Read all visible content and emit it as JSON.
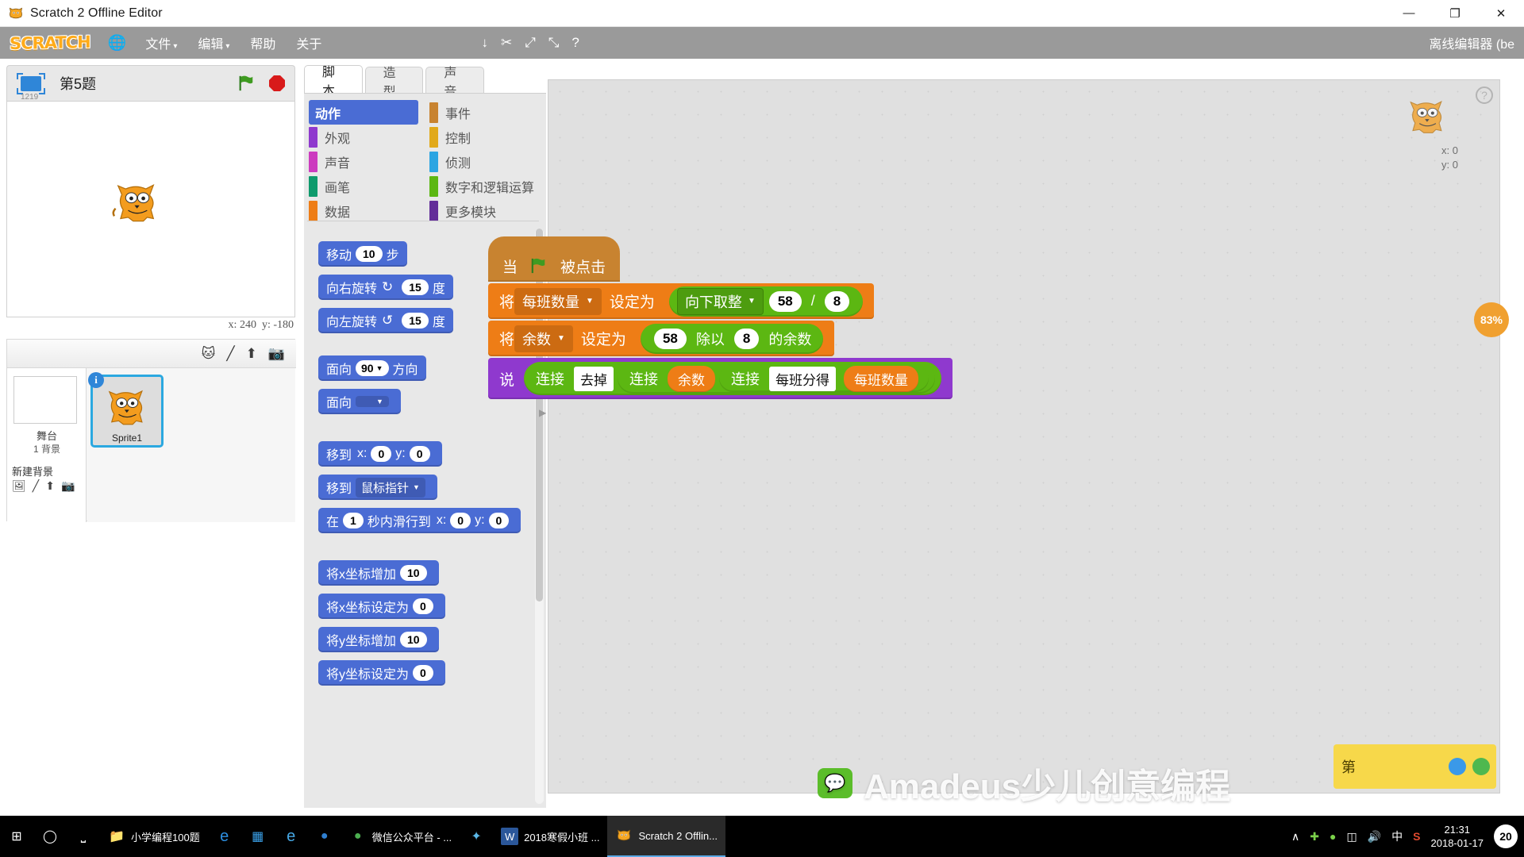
{
  "window": {
    "title": "Scratch 2 Offline Editor",
    "icon": "scratch-cat-icon",
    "minimize": "—",
    "maximize": "❐",
    "close": "✕"
  },
  "menubar": {
    "logo": "SCRATCH",
    "globe_icon": "globe-icon",
    "items": [
      {
        "label": "文件",
        "caret": "▾"
      },
      {
        "label": "编辑",
        "caret": "▾"
      },
      {
        "label": "帮助",
        "caret": ""
      },
      {
        "label": "关于",
        "caret": ""
      }
    ],
    "tools": [
      "↓",
      "✂",
      "⤢",
      "⤡",
      "?"
    ],
    "right_text": "离线编辑器 (be"
  },
  "stage": {
    "mini_number": "1219",
    "project_title": "第5题",
    "green_flag_icon": "green-flag-icon",
    "stop_icon": "stop-button-icon",
    "coords": {
      "x_label": "x:",
      "x_value": "240",
      "y_label": "y:",
      "y_value": "-180"
    }
  },
  "sprite_pane": {
    "tools": [
      "✨",
      "╱",
      "↑",
      "■"
    ],
    "stage_label": "舞台",
    "stage_sublabel": "1 背景",
    "new_bg_label": "新建背景",
    "new_bg_tools": [
      "Ὓc",
      "╱",
      "↑",
      "■"
    ],
    "sprites": [
      {
        "name": "Sprite1",
        "badge": "i"
      }
    ]
  },
  "editor_tabs": [
    {
      "label": "脚本",
      "active": true
    },
    {
      "label": "造型",
      "active": false
    },
    {
      "label": "声音",
      "active": false
    }
  ],
  "palette": {
    "categories_left": [
      {
        "label": "动作",
        "color": "#4a6cd4",
        "selected": true
      },
      {
        "label": "外观",
        "color": "#8f39ce",
        "selected": false
      },
      {
        "label": "声音",
        "color": "#cc3bbf",
        "selected": false
      },
      {
        "label": "画笔",
        "color": "#0e9a6c",
        "selected": false
      },
      {
        "label": "数据",
        "color": "#ee7d16",
        "selected": false
      }
    ],
    "categories_right": [
      {
        "label": "事件",
        "color": "#c88330",
        "selected": false
      },
      {
        "label": "控制",
        "color": "#e1a91a",
        "selected": false
      },
      {
        "label": "侦测",
        "color": "#2ca5e2",
        "selected": false
      },
      {
        "label": "数字和逻辑运算",
        "color": "#5cb712",
        "selected": false
      },
      {
        "label": "更多模块",
        "color": "#632d99",
        "selected": false
      }
    ],
    "blocks": [
      {
        "id": "move-steps",
        "parts": [
          {
            "t": "text",
            "v": "移动"
          },
          {
            "t": "oval",
            "v": "10"
          },
          {
            "t": "text",
            "v": "步"
          }
        ]
      },
      {
        "id": "turn-right",
        "parts": [
          {
            "t": "text",
            "v": "向右旋转"
          },
          {
            "t": "icon",
            "v": "↻"
          },
          {
            "t": "oval",
            "v": "15"
          },
          {
            "t": "text",
            "v": "度"
          }
        ]
      },
      {
        "id": "turn-left",
        "parts": [
          {
            "t": "text",
            "v": "向左旋转"
          },
          {
            "t": "icon",
            "v": "↺"
          },
          {
            "t": "oval",
            "v": "15"
          },
          {
            "t": "text",
            "v": "度"
          }
        ]
      },
      {
        "id": "point-in-direction",
        "parts": [
          {
            "t": "text",
            "v": "面向"
          },
          {
            "t": "ovaldrop",
            "v": "90"
          },
          {
            "t": "text",
            "v": "方向"
          }
        ]
      },
      {
        "id": "point-towards",
        "parts": [
          {
            "t": "text",
            "v": "面向"
          },
          {
            "t": "drop",
            "v": ""
          }
        ]
      },
      {
        "id": "go-to-xy",
        "parts": [
          {
            "t": "text",
            "v": "移到"
          },
          {
            "t": "text",
            "v": "x:"
          },
          {
            "t": "oval",
            "v": "0"
          },
          {
            "t": "text",
            "v": "y:"
          },
          {
            "t": "oval",
            "v": "0"
          }
        ]
      },
      {
        "id": "go-to-pointer",
        "parts": [
          {
            "t": "text",
            "v": "移到"
          },
          {
            "t": "drop",
            "v": "鼠标指针"
          }
        ]
      },
      {
        "id": "glide-secs",
        "parts": [
          {
            "t": "text",
            "v": "在"
          },
          {
            "t": "oval",
            "v": "1"
          },
          {
            "t": "text",
            "v": "秒内滑行到"
          },
          {
            "t": "text",
            "v": "x:"
          },
          {
            "t": "oval",
            "v": "0"
          },
          {
            "t": "text",
            "v": "y:"
          },
          {
            "t": "oval",
            "v": "0"
          }
        ]
      },
      {
        "id": "change-x-by",
        "parts": [
          {
            "t": "text",
            "v": "将x坐标增加"
          },
          {
            "t": "oval",
            "v": "10"
          }
        ]
      },
      {
        "id": "set-x-to",
        "parts": [
          {
            "t": "text",
            "v": "将x坐标设定为"
          },
          {
            "t": "oval",
            "v": "0"
          }
        ]
      },
      {
        "id": "change-y-by",
        "parts": [
          {
            "t": "text",
            "v": "将y坐标增加"
          },
          {
            "t": "oval",
            "v": "10"
          }
        ]
      },
      {
        "id": "set-y-to",
        "parts": [
          {
            "t": "text",
            "v": "将y坐标设定为"
          },
          {
            "t": "oval",
            "v": "0"
          }
        ]
      }
    ]
  },
  "script": {
    "hat": {
      "when": "当",
      "flag_icon": "green-flag-icon",
      "clicked": "被点击"
    },
    "set_block_1": {
      "set_word": "将",
      "variable": "每班数量",
      "to_word": "设定为",
      "operator": "向下取整",
      "operand_a": "58",
      "op_symbol": "/",
      "operand_b": "8"
    },
    "set_block_2": {
      "set_word": "将",
      "variable": "余数",
      "to_word": "设定为",
      "operand_a": "58",
      "mid_word": "除以",
      "operand_b": "8",
      "end_word": "的余数"
    },
    "say_block": {
      "say_word": "说",
      "join1": "连接",
      "text1": "去掉",
      "join2": "连接",
      "var1": "余数",
      "join3": "连接",
      "text2": "每班分得",
      "var2": "每班数量"
    }
  },
  "canvas": {
    "sprite_x_label": "x:",
    "sprite_x_value": "0",
    "sprite_y_label": "y:",
    "sprite_y_value": "0",
    "help_icon": "question-mark-icon",
    "zoom_badge": "83%"
  },
  "watermark": {
    "text": "Amadeus少儿创意编程",
    "badge_icon": "wechat-icon",
    "popup_text": "第"
  },
  "taskbar": {
    "start_icon": "windows-start-icon",
    "search_icon": "search-icon",
    "taskview_icon": "task-view-icon",
    "buttons": [
      {
        "label": "小学编程100题",
        "icon": "folder-icon",
        "active": false
      },
      {
        "label": "",
        "icon": "edge-icon",
        "active": false
      },
      {
        "label": "",
        "icon": "store-icon",
        "active": false
      },
      {
        "label": "",
        "icon": "ie-icon",
        "active": false
      },
      {
        "label": "",
        "icon": "browser-icon",
        "active": false
      },
      {
        "label": "微信公众平台 - ...",
        "icon": "browser-green-icon",
        "active": false
      },
      {
        "label": "",
        "icon": "app-blue-icon",
        "active": false
      },
      {
        "label": "2018寒假小班 ...",
        "icon": "word-icon",
        "active": false
      },
      {
        "label": "Scratch 2 Offlin...",
        "icon": "scratch-cat-icon",
        "active": true
      }
    ],
    "tray": {
      "chevron": "∧",
      "icons": [
        "shield-green-icon",
        "browser-green-icon",
        "battery-icon",
        "volume-icon"
      ],
      "ime": "中",
      "sogou": "S",
      "time": "21:31",
      "date": "2018-01-17",
      "notification_count": "20"
    }
  }
}
